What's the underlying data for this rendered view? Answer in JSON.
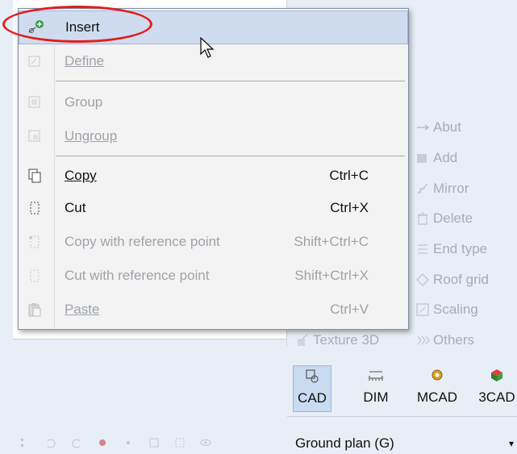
{
  "menu": {
    "items": [
      {
        "label": "Insert",
        "shortcut": "",
        "enabled": true,
        "icon": "insert-icon"
      },
      {
        "label": "Define",
        "shortcut": "",
        "enabled": false,
        "icon": "define-icon"
      },
      {
        "label": "Group",
        "shortcut": "",
        "enabled": false,
        "icon": "group-icon"
      },
      {
        "label": "Ungroup",
        "shortcut": "",
        "enabled": false,
        "icon": "ungroup-icon"
      },
      {
        "label": "Copy",
        "shortcut": "Ctrl+C",
        "enabled": true,
        "icon": "copy-icon"
      },
      {
        "label": "Cut",
        "shortcut": "Ctrl+X",
        "enabled": true,
        "icon": "cut-icon"
      },
      {
        "label": "Copy with reference point",
        "shortcut": "Shift+Ctrl+C",
        "enabled": false,
        "icon": "copy-reference-icon"
      },
      {
        "label": "Cut with reference point",
        "shortcut": "Shift+Ctrl+X",
        "enabled": false,
        "icon": "cut-reference-icon"
      },
      {
        "label": "Paste",
        "shortcut": "Ctrl+V",
        "enabled": false,
        "icon": "paste-icon"
      }
    ]
  },
  "ribbon": {
    "tools": [
      "Abut",
      "Add",
      "Mirror",
      "Delete",
      "End type",
      "Roof grid",
      "Scaling",
      "Texture 3D",
      "Others"
    ],
    "tabs": [
      {
        "label": "CAD",
        "active": true
      },
      {
        "label": "DIM",
        "active": false
      },
      {
        "label": "MCAD",
        "active": false
      },
      {
        "label": "3CAD",
        "active": false
      }
    ],
    "view_select": "Ground plan  (G)"
  },
  "colors": {
    "highlight": "#cfdcef",
    "annotation_ring": "#e01e1e",
    "disabled_text": "#9ea3a9"
  }
}
